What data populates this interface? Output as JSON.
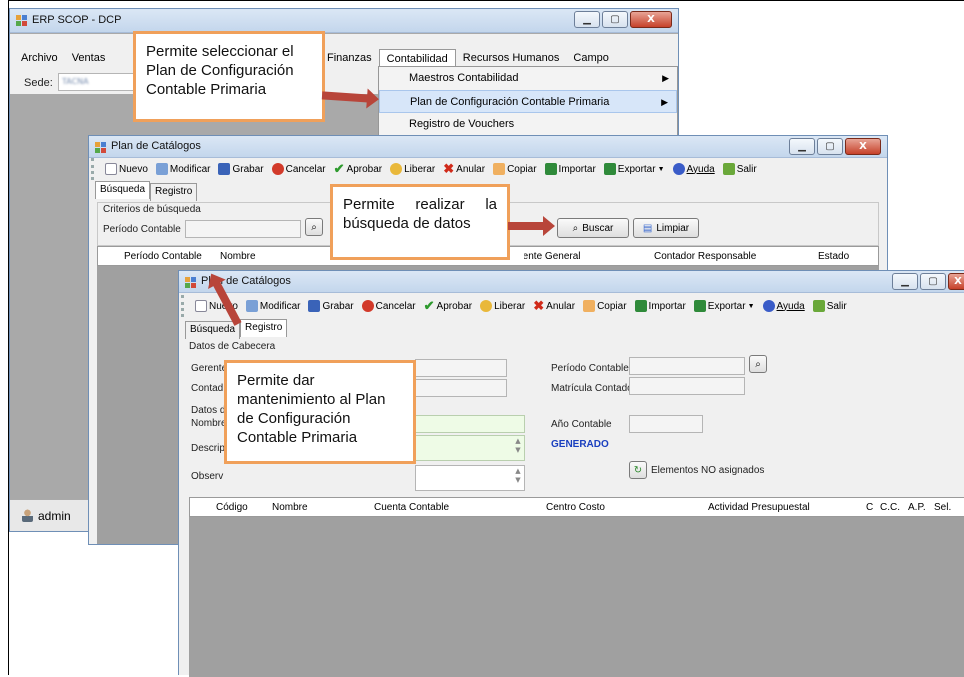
{
  "erp_window": {
    "title": "ERP SCOP - DCP",
    "menu": [
      "Archivo",
      "Ventas",
      "Finanzas",
      "Contabilidad",
      "Recursos Humanos",
      "Campo"
    ],
    "sede_label": "Sede:",
    "sede_value": "TACNA",
    "status_user": "admin",
    "contabilidad_menu": [
      "Maestros Contabilidad",
      "Plan de Configuración Contable Primaria",
      "Registro de Vouchers"
    ]
  },
  "toolbar": {
    "nuevo": "Nuevo",
    "modificar": "Modificar",
    "grabar": "Grabar",
    "cancelar": "Cancelar",
    "aprobar": "Aprobar",
    "liberar": "Liberar",
    "anular": "Anular",
    "copiar": "Copiar",
    "importar": "Importar",
    "exportar": "Exportar",
    "ayuda": "Ayuda",
    "salir": "Salir"
  },
  "catalog_search": {
    "title": "Plan de Catálogos",
    "tabs": [
      "Búsqueda",
      "Registro"
    ],
    "criteria_label": "Criterios de búsqueda",
    "period_label": "Período Contable",
    "buscar": "Buscar",
    "limpiar": "Limpiar",
    "columns": [
      "Período Contable",
      "Nombre",
      "Gerente General",
      "Contador Responsable",
      "Estado"
    ]
  },
  "catalog_register": {
    "title": "Plan de Catálogos",
    "tabs": [
      "Búsqueda",
      "Registro"
    ],
    "cabecera_label": "Datos de Cabecera",
    "gerente_label": "Gerente",
    "contador_label": "Contad",
    "periodo_label": "Período Contable",
    "matricula_label": "Matrícula Contador",
    "datos_label": "Datos d",
    "nombre_label": "Nombre",
    "descripcion_label": "Descrip",
    "observacion_label": "Observ",
    "anio_label": "Año Contable",
    "status": "GENERADO",
    "elementos_button": "Elementos NO asignados",
    "columns": [
      "Código",
      "Nombre",
      "Cuenta Contable",
      "Centro Costo",
      "Actividad Presupuestal",
      "C",
      "C.C.",
      "A.P.",
      "Sel."
    ]
  },
  "callouts": {
    "select_plan": "Permite seleccionar el Plan de Configuración Contable Primaria",
    "search": "Permite realizar la búsqueda de datos",
    "maintain": "Permite dar mantenimiento al Plan de Configuración Contable Primaria"
  },
  "colors": {
    "callout_border": "#f0a05a",
    "arrow": "#b8453a",
    "status_blue": "#1a3fbf"
  }
}
